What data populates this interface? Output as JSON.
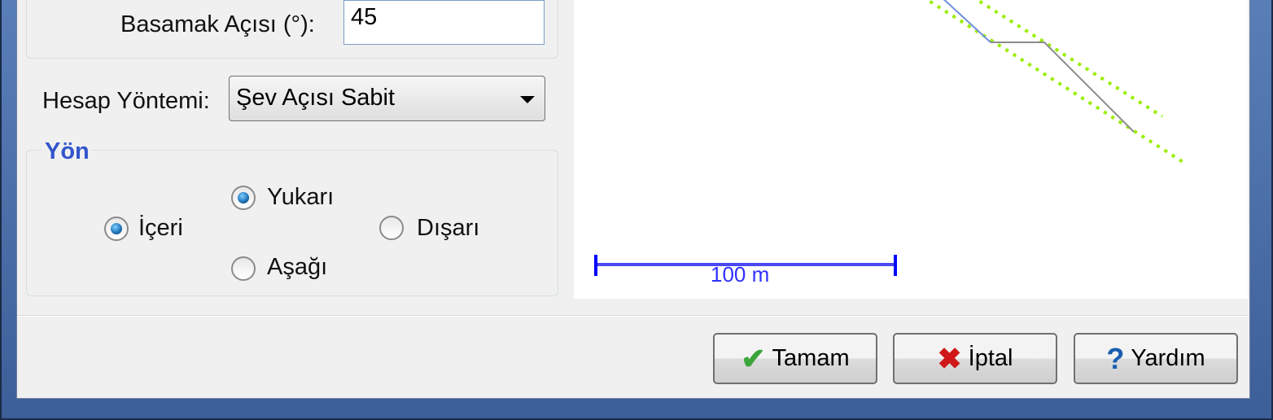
{
  "form": {
    "step_angle_label": "Basamak Açısı (°):",
    "step_angle_value": "45",
    "method_label": "Hesap Yöntemi:",
    "method_selected": "Şev Açısı Sabit",
    "direction_group": {
      "title": "Yön",
      "options": [
        {
          "label": "İçeri",
          "checked": true
        },
        {
          "label": "Yukarı",
          "checked": true
        },
        {
          "label": "Dışarı",
          "checked": false
        },
        {
          "label": "Aşağı",
          "checked": false
        }
      ]
    }
  },
  "preview": {
    "scale_label": "100 m",
    "colors": {
      "slope_top": "#6f8fe0",
      "bench": "#8c8c8c",
      "guide": "#99ee00",
      "scale": "#0000ff"
    }
  },
  "buttons": {
    "ok": "Tamam",
    "cancel": "İptal",
    "help": "Yardım"
  },
  "icons": {
    "ok": "check-icon",
    "cancel": "x-icon",
    "help": "question-icon"
  }
}
